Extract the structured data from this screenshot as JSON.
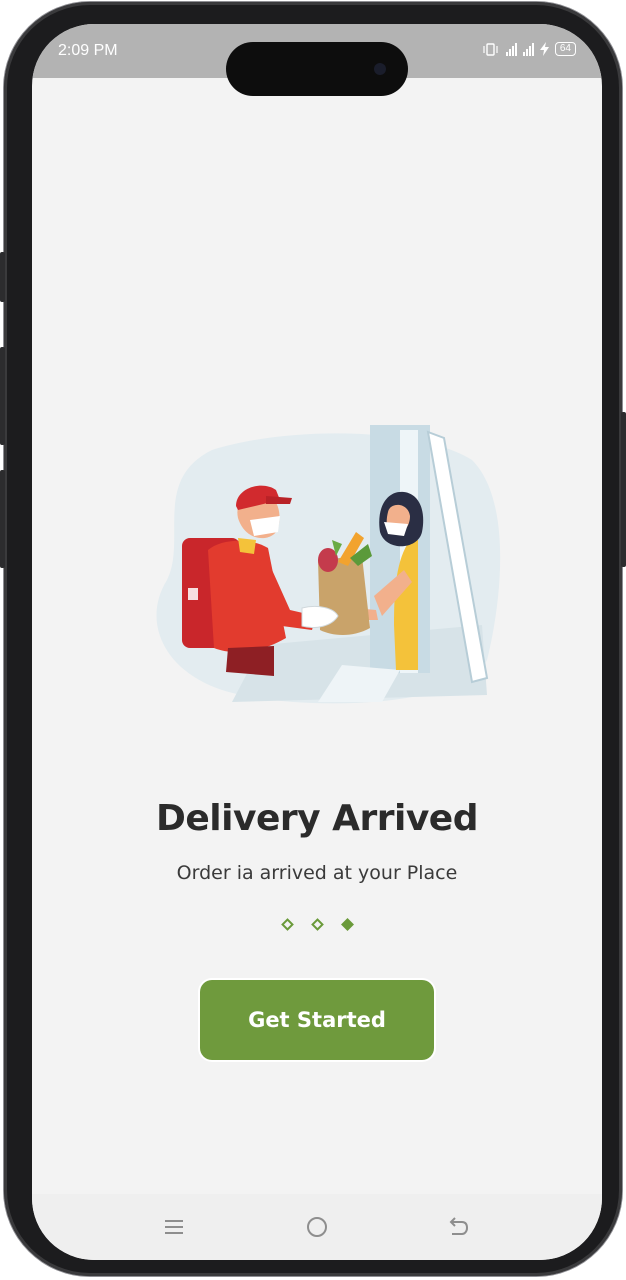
{
  "status_bar": {
    "time": "2:09 PM",
    "battery_level": "64",
    "icons": [
      "vibrate-icon",
      "signal-icon",
      "signal-icon",
      "charging-icon",
      "battery-icon"
    ]
  },
  "onboarding": {
    "title": "Delivery Arrived",
    "subtitle": "Order ia arrived at your Place",
    "page_indicator": {
      "total": 3,
      "active_index": 2
    },
    "cta_label": "Get Started",
    "illustration": "delivery-handoff-illustration"
  },
  "nav_bar": {
    "buttons": [
      "menu-icon",
      "home-icon",
      "back-icon"
    ]
  },
  "colors": {
    "accent": "#6f9a3d",
    "background": "#f3f3f3",
    "status_bar": "#b3b3b3",
    "text_primary": "#2b2b2b"
  }
}
